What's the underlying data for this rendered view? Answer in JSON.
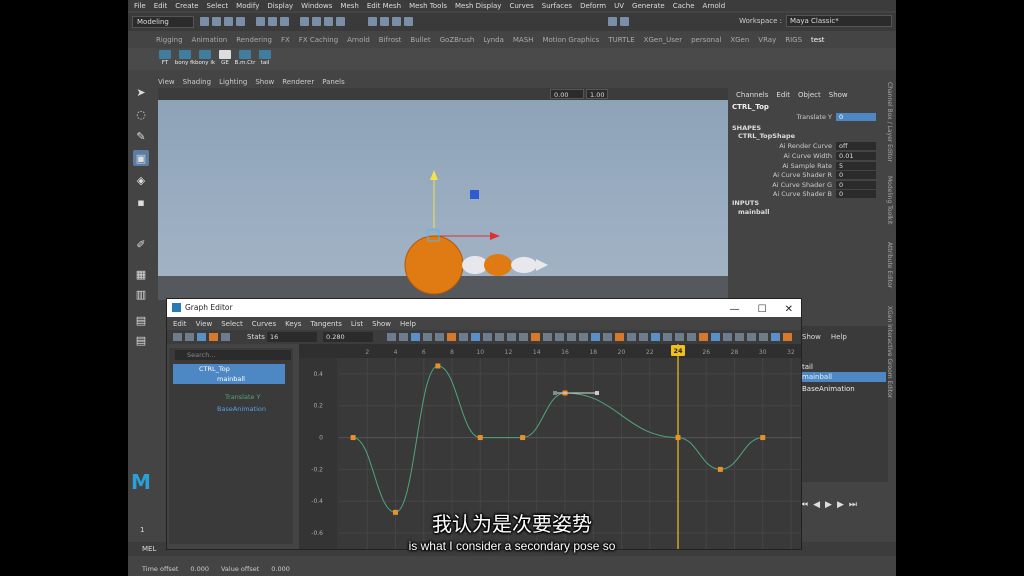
{
  "menubar": [
    "File",
    "Edit",
    "Create",
    "Select",
    "Modify",
    "Display",
    "Windows",
    "Mesh",
    "Edit Mesh",
    "Mesh Tools",
    "Mesh Display",
    "Curves",
    "Surfaces",
    "Deform",
    "UV",
    "Generate",
    "Cache",
    "Arnold"
  ],
  "toolbar": {
    "mode": "Modeling",
    "workspace_label": "Workspace :",
    "workspace_value": "Maya Classic*"
  },
  "shelf_tabs": [
    "Rigging",
    "Animation",
    "Rendering",
    "FX",
    "FX Caching",
    "Arnold",
    "Bifrost",
    "Bullet",
    "GoZBrush",
    "Lynda",
    "MASH",
    "Motion Graphics",
    "TURTLE",
    "XGen_User",
    "personal",
    "XGen",
    "VRay",
    "RIGS",
    "test"
  ],
  "shelf_active": "test",
  "shelf_buttons": [
    "FT",
    "bony fk",
    "bony ik",
    "GE",
    "B.m.Ctr",
    "tail"
  ],
  "viewport": {
    "menu": [
      "View",
      "Shading",
      "Lighting",
      "Show",
      "Renderer",
      "Panels"
    ],
    "field_a": "0.00",
    "field_b": "1.00"
  },
  "channel_box": {
    "menu": [
      "Channels",
      "Edit",
      "Object",
      "Show"
    ],
    "node": "CTRL_Top",
    "attrs": [
      {
        "name": "Translate Y",
        "value": "0"
      }
    ],
    "shapes_title": "SHAPES",
    "shape_node": "CTRL_TopShape",
    "shape_attrs": [
      {
        "name": "Ai Render Curve",
        "value": "off"
      },
      {
        "name": "Ai Curve Width",
        "value": "0.01"
      },
      {
        "name": "Ai Sample Rate",
        "value": "5"
      },
      {
        "name": "Ai Curve Shader R",
        "value": "0"
      },
      {
        "name": "Ai Curve Shader G",
        "value": "0"
      },
      {
        "name": "Ai Curve Shader B",
        "value": "0"
      }
    ],
    "inputs_title": "INPUTS",
    "input_node": "mainball"
  },
  "side_tabs": [
    "Channel Box / Layer Editor",
    "Modeling Toolkit",
    "Attribute Editor",
    "XGen Interactive Groom Editor"
  ],
  "outliner": {
    "menu": [
      "Show",
      "Help"
    ],
    "items": [
      "tail",
      "mainball",
      "BaseAnimation"
    ]
  },
  "graph_editor": {
    "title": "Graph Editor",
    "menu": [
      "Edit",
      "View",
      "Select",
      "Curves",
      "Keys",
      "Tangents",
      "List",
      "Show",
      "Help"
    ],
    "stats_label": "Stats",
    "stats_a": "16",
    "stats_b": "0.280",
    "search_placeholder": "Search...",
    "outliner_items": [
      {
        "label": "CTRL_Top",
        "selected": true
      },
      {
        "label": "mainball",
        "selected": true
      },
      {
        "label": "Translate Y",
        "selected": false
      },
      {
        "label": "BaseAnimation",
        "selected": false
      }
    ],
    "ruler_labels": [
      "2",
      "4",
      "6",
      "8",
      "10",
      "12",
      "14",
      "16",
      "18",
      "20",
      "22",
      "24",
      "26",
      "28",
      "30",
      "32"
    ],
    "current_frame": "24",
    "y_labels": [
      "0.4",
      "0.2",
      "0",
      "-0.2",
      "-0.4",
      "-0.6"
    ]
  },
  "chart_data": {
    "type": "line",
    "series": [
      {
        "x": [
          1,
          4,
          7,
          10,
          13,
          16,
          24,
          27,
          30
        ],
        "y": [
          0,
          -0.47,
          0.45,
          0,
          0,
          0.28,
          0,
          -0.2,
          0
        ]
      }
    ],
    "ylim": [
      -0.65,
      0.5
    ],
    "xlim": [
      0,
      32
    ]
  },
  "bottom": {
    "mel_label": "MEL",
    "time_offset_label": "Time offset",
    "time_offset_value": "0.000",
    "value_offset_label": "Value offset",
    "value_offset_value": "0.000",
    "frame_field": "1"
  },
  "subtitles": {
    "cn": "我认为是次要姿势",
    "en": "is what I consider a secondary pose so"
  },
  "colors": {
    "accent": "#4d88c5",
    "curve": "#4ea67a",
    "key": "#e8902a",
    "current_time": "#f2c01a"
  }
}
